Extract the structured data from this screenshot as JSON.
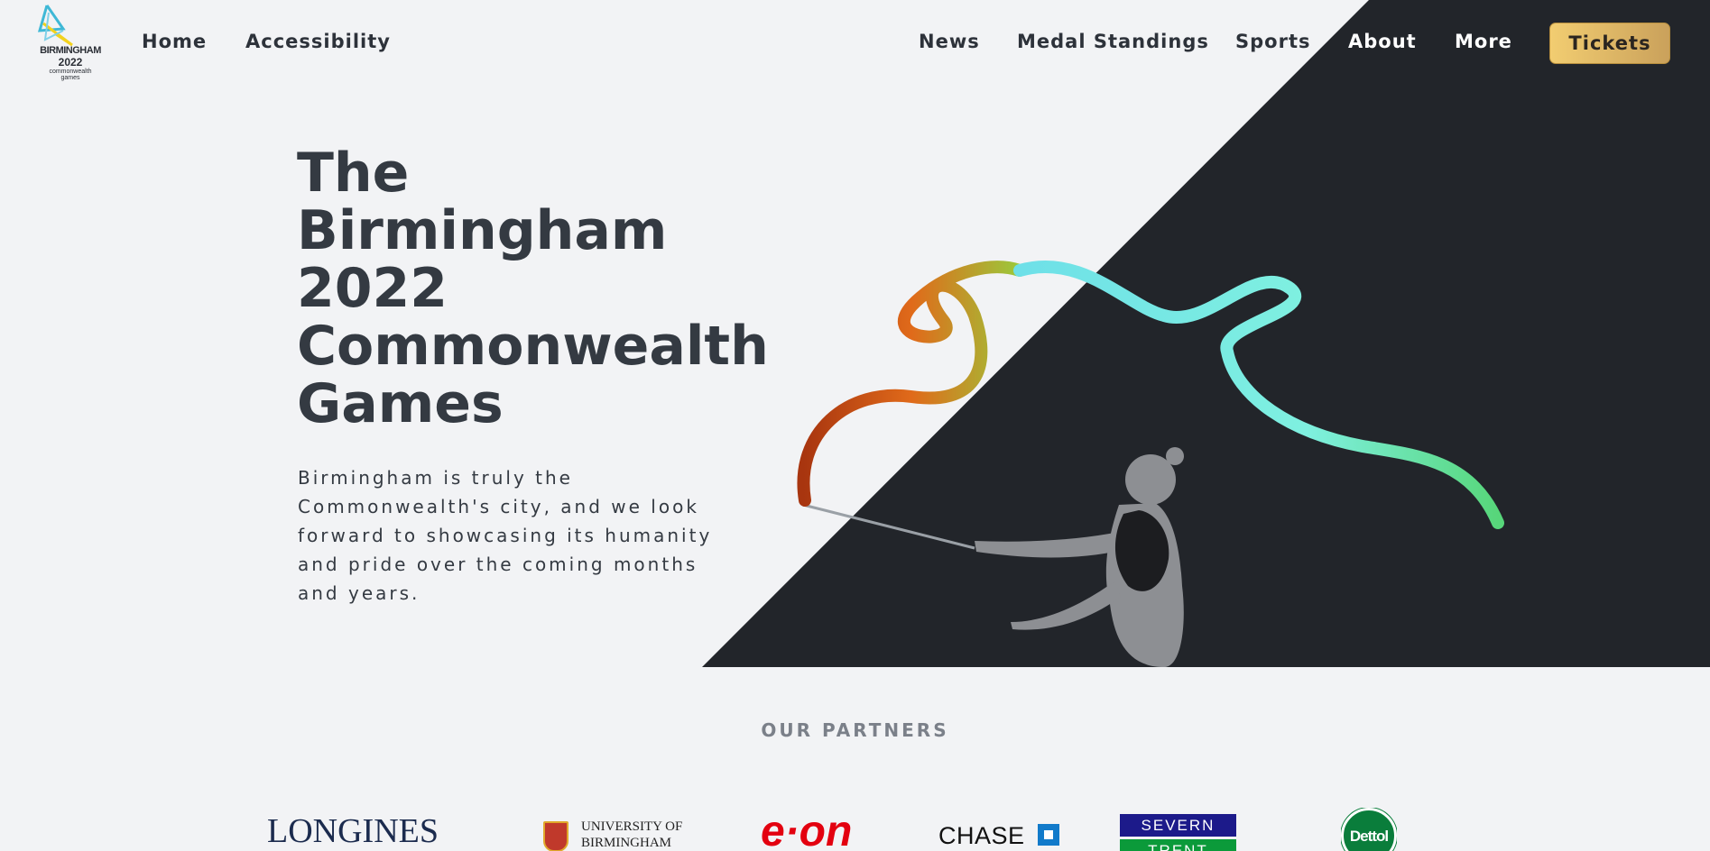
{
  "logo": {
    "word": "BIRMINGHAM",
    "year": "2022",
    "sub_line1": "commonwealth",
    "sub_line2": "games"
  },
  "nav": {
    "left": [
      {
        "label": "Home"
      },
      {
        "label": "Accessibility"
      }
    ],
    "right": [
      {
        "label": "News"
      },
      {
        "label": "Medal Standings"
      },
      {
        "label": "Sports"
      },
      {
        "label": "About"
      },
      {
        "label": "More"
      }
    ],
    "cta": {
      "label": "Tickets",
      "color": "#e8c06a"
    }
  },
  "hero": {
    "title_lines": [
      "The",
      "Birmingham",
      "2022",
      "Commonwealth",
      "Games"
    ],
    "text_lines": [
      "Birmingham is truly the",
      "Commonwealth's city, and we look",
      "forward to showcasing its humanity",
      "and pride over the coming months",
      "and years."
    ],
    "dark_panel_color": "#22252a"
  },
  "partners": {
    "heading": "OUR PARTNERS",
    "logos": [
      {
        "name": "LONGINES",
        "icon": "longines-logo"
      },
      {
        "name_line1": "UNIVERSITY OF",
        "name_line2": "BIRMINGHAM",
        "icon": "university-crest-icon"
      },
      {
        "name": "e·on",
        "icon": "eon-logo"
      },
      {
        "name": "CHASE",
        "icon": "chase-octagon-icon"
      },
      {
        "name_line1": "SEVERN",
        "name_line2": "TRENT",
        "icon": "severn-trent-logo"
      },
      {
        "name": "Dettol",
        "icon": "dettol-logo"
      }
    ]
  },
  "colors": {
    "background": "#f2f3f5",
    "text_dark": "#343a42",
    "tickets_gold": "#e8c06a"
  }
}
